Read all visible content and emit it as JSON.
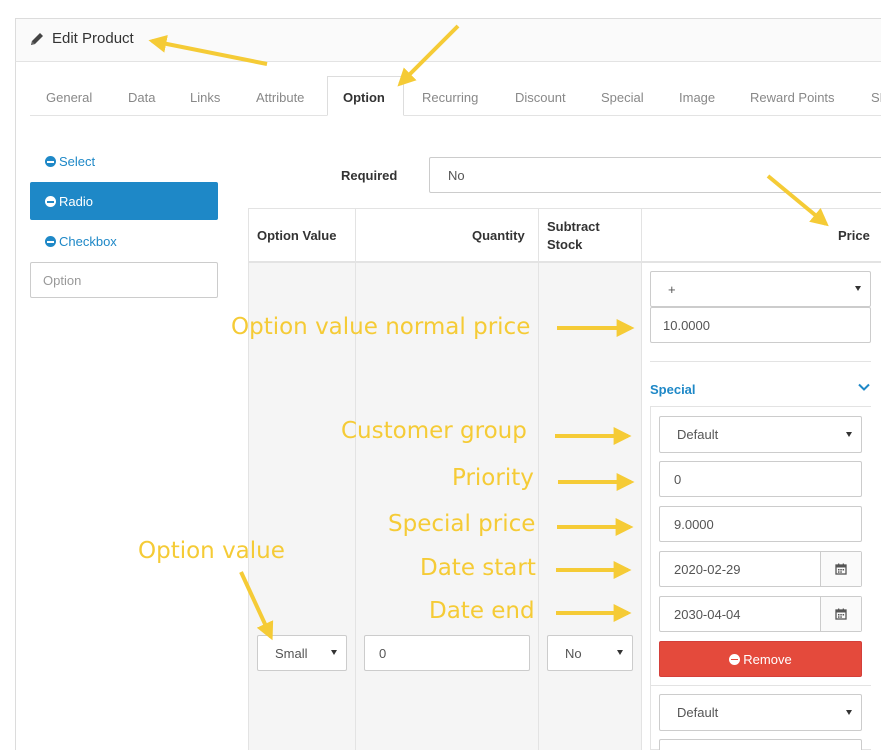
{
  "header": {
    "title": "Edit Product",
    "icon": "pencil-icon"
  },
  "tabs": [
    {
      "label": "General"
    },
    {
      "label": "Data"
    },
    {
      "label": "Links"
    },
    {
      "label": "Attribute"
    },
    {
      "label": "Option",
      "active": true
    },
    {
      "label": "Recurring"
    },
    {
      "label": "Discount"
    },
    {
      "label": "Special"
    },
    {
      "label": "Image"
    },
    {
      "label": "Reward Points"
    },
    {
      "label": "SE"
    }
  ],
  "option_list": {
    "items": [
      {
        "label": "Select"
      },
      {
        "label": "Radio",
        "active": true
      },
      {
        "label": "Checkbox"
      }
    ],
    "search_placeholder": "Option"
  },
  "required": {
    "label": "Required",
    "value": "No"
  },
  "table": {
    "headers": {
      "option_value": "Option Value",
      "quantity": "Quantity",
      "subtract_stock": "Subtract Stock",
      "price": "Price"
    },
    "row": {
      "option_value": "Small",
      "quantity": "0",
      "subtract_stock": "No",
      "price_prefix": "+",
      "price": "10.0000"
    }
  },
  "special": {
    "title": "Special",
    "customer_group": "Default",
    "priority": "0",
    "price": "9.0000",
    "date_start": "2020-02-29",
    "date_end": "2030-04-04",
    "remove_label": "Remove",
    "next_customer_group": "Default"
  },
  "annotations": {
    "normal_price": "Option value normal price",
    "customer_group": "Customer group",
    "priority": "Priority",
    "special_price": "Special price",
    "date_start": "Date start",
    "date_end": "Date end",
    "option_value": "Option value"
  },
  "colors": {
    "accent": "#1e88c7",
    "danger": "#e44a3c",
    "annotation": "#f5cb36"
  }
}
